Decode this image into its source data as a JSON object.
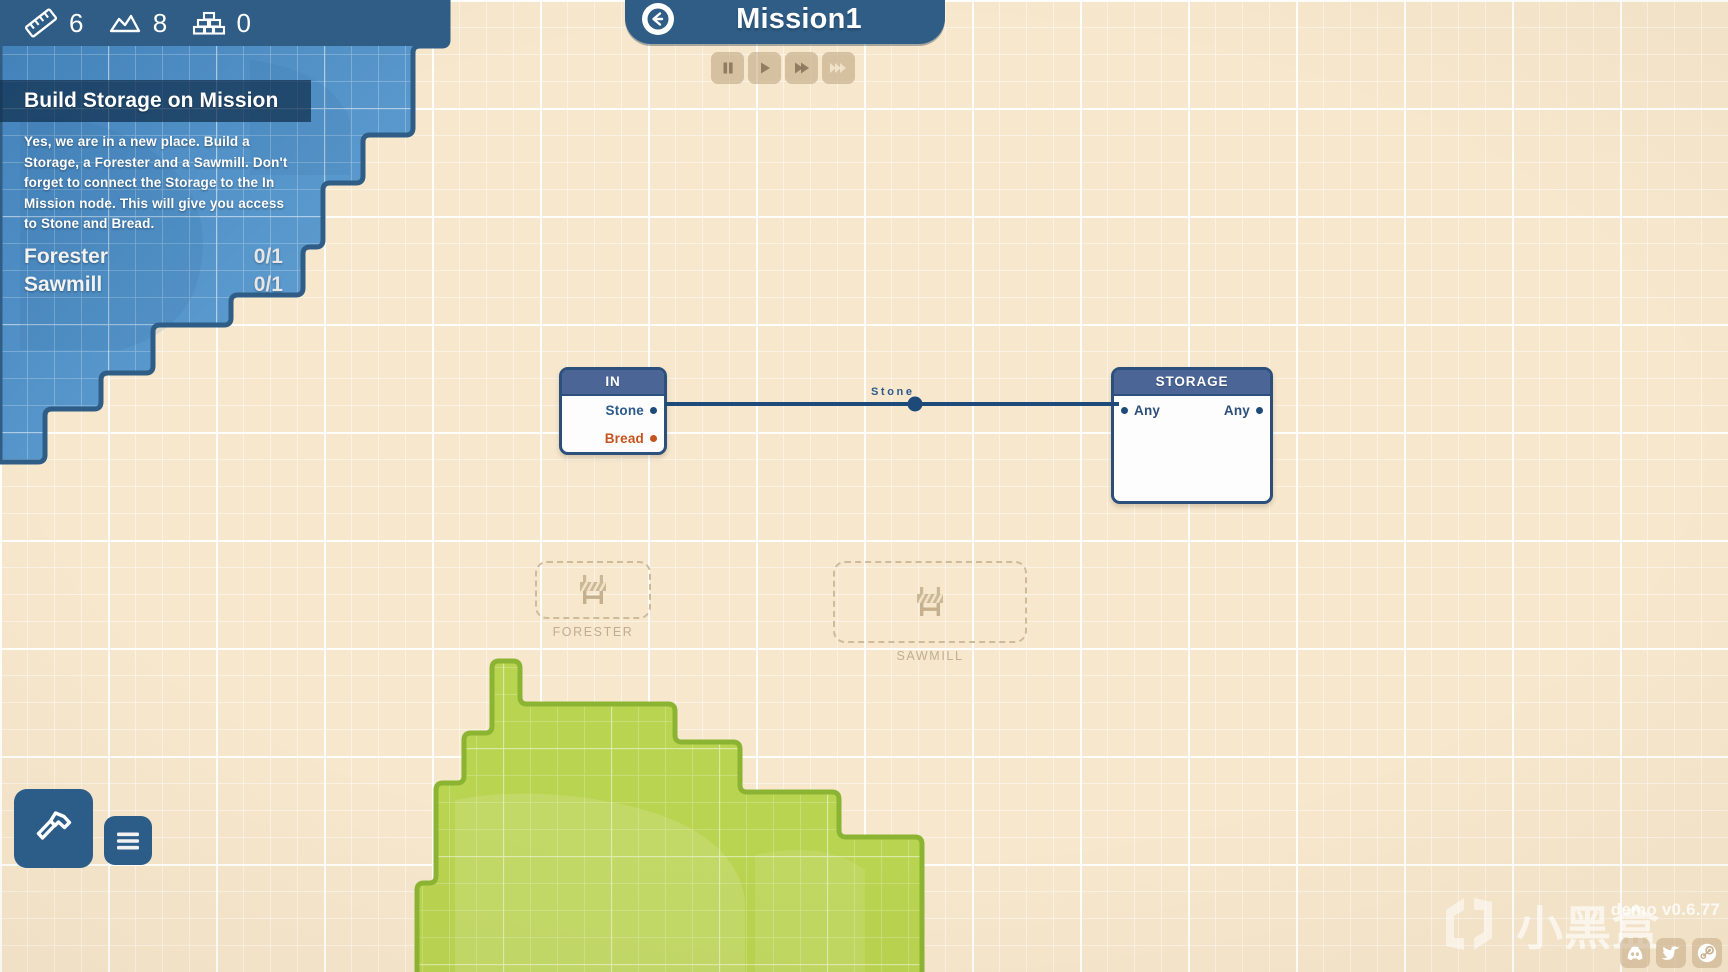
{
  "hud": {
    "resources": [
      {
        "icon": "ruler-icon",
        "name": "blueprint",
        "value": "6"
      },
      {
        "icon": "stone-icon",
        "name": "stone",
        "value": "8"
      },
      {
        "icon": "brick-icon",
        "name": "brick",
        "value": "0"
      }
    ]
  },
  "header": {
    "back_icon": "back-arrow-icon",
    "title": "Mission1",
    "playback": [
      {
        "name": "pause",
        "icon": "pause-icon"
      },
      {
        "name": "play",
        "icon": "play-icon"
      },
      {
        "name": "fast-forward",
        "icon": "fast-forward-icon"
      },
      {
        "name": "ultra-fast-forward",
        "icon": "ultra-fast-forward-icon"
      }
    ]
  },
  "mission_panel": {
    "title": "Build Storage on Mission",
    "description": "Yes, we are in a new place. Build a Storage, a Forester and a Sawmill. Don't forget to connect the Storage to the In Mission node. This will give you access to Stone and Bread.",
    "goals": [
      {
        "label": "Forester",
        "progress": "0/1"
      },
      {
        "label": "Sawmill",
        "progress": "0/1"
      }
    ]
  },
  "graph": {
    "nodes": [
      {
        "id": "in",
        "title": "IN",
        "outputs": [
          {
            "label": "Stone",
            "color": "#2c5a8c"
          },
          {
            "label": "Bread",
            "color": "#c4541f"
          }
        ]
      },
      {
        "id": "storage",
        "title": "STORAGE",
        "inputs": [
          {
            "label": "Any",
            "color": "#2c4f7c"
          }
        ],
        "outputs": [
          {
            "label": "Any",
            "color": "#2c4f7c"
          }
        ]
      }
    ],
    "connections": [
      {
        "from": "in.Stone",
        "to": "storage.Any",
        "label": "Stone"
      }
    ]
  },
  "placeholders": [
    {
      "id": "forester",
      "label": "FORESTER",
      "icon": "construction-barrier-icon"
    },
    {
      "id": "sawmill",
      "label": "SAWMILL",
      "icon": "construction-barrier-icon"
    }
  ],
  "toolbar": {
    "build_button": {
      "name": "build-button",
      "icon": "hammer-icon"
    },
    "menu_button": {
      "name": "menu-button",
      "icon": "hamburger-menu-icon"
    }
  },
  "watermark": {
    "logo_text": "小黑盒",
    "version": "demo v0.6.77",
    "socials": [
      {
        "name": "discord",
        "icon": "discord-icon"
      },
      {
        "name": "twitter",
        "icon": "twitter-icon"
      },
      {
        "name": "steam",
        "icon": "steam-icon"
      }
    ]
  },
  "colors": {
    "paper": "#f6e7cd",
    "water": "#4f8fc4",
    "forest": "#b7d44e",
    "node_border": "#2c4f7c",
    "node_head": "#4a6596",
    "ui_blue": "#2f5d86"
  }
}
